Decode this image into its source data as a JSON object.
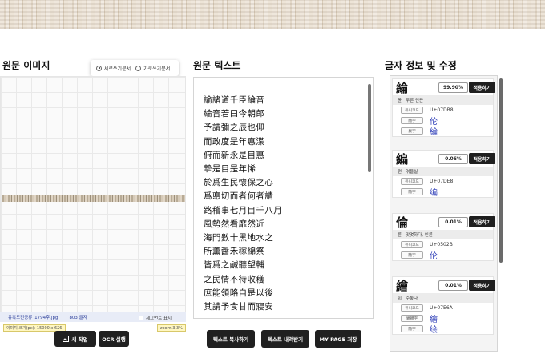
{
  "left_panel": {
    "title": "원문 이미지",
    "orientation": {
      "vertical_label": "세로쓰기문서",
      "horizontal_label": "가로쓰기문서",
      "selected": "vertical"
    },
    "file_name": "유복도진공류_1794후.jpg",
    "char_count": "803 글자",
    "segment_toggle_label": "세그먼트 표시",
    "image_size_label": "이미지 크기(px): 15000 x 626",
    "zoom_label": "zoom 3.3%",
    "new_job_button": "새 작업",
    "ocr_button": "OCR 실행"
  },
  "middle_panel": {
    "title": "원문 텍스트",
    "lines": [
      "諭諸道千臣綸音",
      "綸音若曰今朝郎",
      "予謂彌之辰也仰",
      "而政度是年悳渫",
      "俯而新永是目悳",
      "摯是目是年悕",
      "於爲生民懷保之心",
      "爲悳切而者何者請",
      "路稽事七月目千八月",
      "風勢然看靡然近",
      "海門數十黑地水之",
      "所薰醬禾稼綿祭",
      "皆爲之鹹聽望輔",
      "之民情不待收穫",
      "庶能領略自是以後",
      "其請予食甘而寢安"
    ],
    "copy_button": "텍스트 복사하기",
    "download_button": "텍스트 내려받기",
    "save_button": "MY PAGE 저장"
  },
  "right_panel": {
    "title": "글자 정보 및 수정",
    "apply_label": "적용하기",
    "code_tag": "유니코드",
    "cards": [
      {
        "glyph": "綸",
        "confidence": "99.90%",
        "reading": "윤",
        "meaning": "푸른 인끈",
        "unicode": "U+07DB8",
        "tags": [
          "簡字",
          "異字"
        ],
        "variants": [
          "伦",
          "綸"
        ]
      },
      {
        "glyph": "編",
        "confidence": "0.06%",
        "reading": "편",
        "meaning": "엮을실",
        "unicode": "U+07DE8",
        "tags": [
          "簡字"
        ],
        "variants": [
          "编"
        ]
      },
      {
        "glyph": "倫",
        "confidence": "0.01%",
        "reading": "륜",
        "meaning": "맛몇하다, 인륜",
        "unicode": "U+0502B",
        "tags": [
          "簡字"
        ],
        "variants": [
          "伦"
        ]
      },
      {
        "glyph": "繪",
        "confidence": "0.01%",
        "reading": "회",
        "meaning": "수놓다",
        "unicode": "U+07E6A",
        "tags": [
          "異體字",
          "簡字"
        ],
        "variants": [
          "繪",
          "绘"
        ]
      }
    ]
  }
}
